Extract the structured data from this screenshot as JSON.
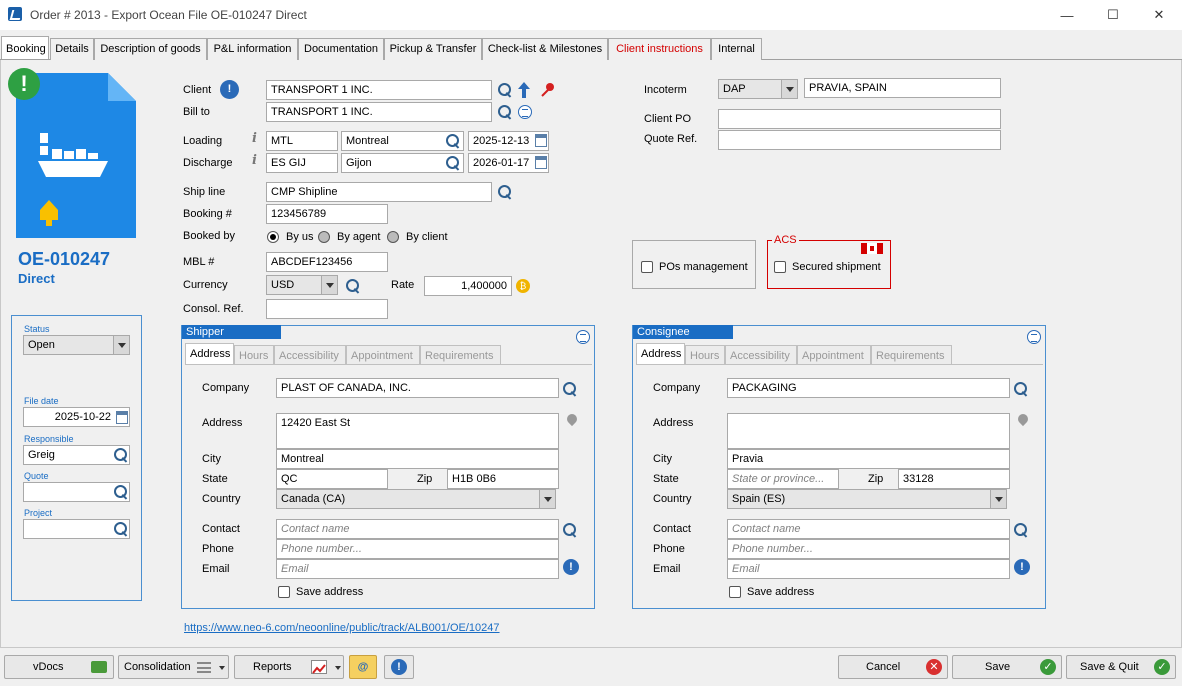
{
  "window": {
    "title": "Order # 2013 - Export Ocean File OE-010247 Direct"
  },
  "tabs": [
    "Booking",
    "Details",
    "Description of goods",
    "P&L information",
    "Documentation",
    "Pickup & Transfer",
    "Check-list & Milestones",
    "Client instructions",
    "Internal"
  ],
  "file": {
    "number": "OE-010247",
    "type": "Direct",
    "status_label": "Status",
    "status_value": "Open",
    "file_date_label": "File date",
    "file_date": "2025-10-22",
    "responsible_label": "Responsible",
    "responsible": "Greig",
    "quote_label": "Quote",
    "quote": "",
    "project_label": "Project",
    "project": ""
  },
  "booking": {
    "client_label": "Client",
    "client": "TRANSPORT 1 INC.",
    "billto_label": "Bill to",
    "billto": "TRANSPORT 1 INC.",
    "loading_label": "Loading",
    "loading_code": "MTL",
    "loading_city": "Montreal",
    "loading_date": "2025-12-13",
    "discharge_label": "Discharge",
    "discharge_code": "ES GIJ",
    "discharge_city": "Gijon",
    "discharge_date": "2026-01-17",
    "shipline_label": "Ship line",
    "shipline": "CMP Shipline",
    "booking_no_label": "Booking #",
    "booking_no": "123456789",
    "booked_by_label": "Booked by",
    "booked_by_options": [
      "By us",
      "By agent",
      "By client"
    ],
    "mbl_label": "MBL #",
    "mbl": "ABCDEF123456",
    "currency_label": "Currency",
    "currency": "USD",
    "rate_label": "Rate",
    "rate": "1,400000",
    "consol_label": "Consol. Ref.",
    "consol": "",
    "incoterm_label": "Incoterm",
    "incoterm": "DAP",
    "incoterm_place": "PRAVIA, SPAIN",
    "client_po_label": "Client PO",
    "client_po": "",
    "quote_ref_label": "Quote Ref.",
    "quote_ref": "",
    "pos_management_label": "POs management",
    "acs_label": "ACS",
    "secured_shipment_label": "Secured shipment"
  },
  "address_tabs": [
    "Address",
    "Hours",
    "Accessibility",
    "Appointment",
    "Requirements"
  ],
  "shipper": {
    "title": "Shipper",
    "company_label": "Company",
    "company": "PLAST OF CANADA, INC.",
    "address_label": "Address",
    "address": "12420 East St",
    "city_label": "City",
    "city": "Montreal",
    "state_label": "State",
    "state": "QC",
    "zip_label": "Zip",
    "zip": "H1B 0B6",
    "country_label": "Country",
    "country": "Canada (CA)",
    "contact_label": "Contact",
    "contact_placeholder": "Contact name",
    "phone_label": "Phone",
    "phone_placeholder": "Phone number...",
    "email_label": "Email",
    "email_placeholder": "Email",
    "save_label": "Save address"
  },
  "consignee": {
    "title": "Consignee",
    "company_label": "Company",
    "company": "PACKAGING",
    "address_label": "Address",
    "address": "",
    "city_label": "City",
    "city": "Pravia",
    "state_label": "State",
    "state_placeholder": "State or province...",
    "zip_label": "Zip",
    "zip": "33128",
    "country_label": "Country",
    "country": "Spain (ES)",
    "contact_label": "Contact",
    "contact_placeholder": "Contact name",
    "phone_label": "Phone",
    "phone_placeholder": "Phone number...",
    "email_label": "Email",
    "email_placeholder": "Email",
    "save_label": "Save address"
  },
  "tracking_link": "https://www.neo-6.com/neoonline/public/track/ALB001/OE/10247",
  "footer": {
    "vdocs": "vDocs",
    "consolidation": "Consolidation",
    "reports": "Reports",
    "cancel": "Cancel",
    "save": "Save",
    "save_quit": "Save & Quit"
  },
  "colors": {
    "accent": "#1a6dc4",
    "file_icon": "#1e88e5",
    "alert_green": "#2ea043",
    "client_instructions_tab": "#d40000",
    "acs_border": "#d40000"
  }
}
